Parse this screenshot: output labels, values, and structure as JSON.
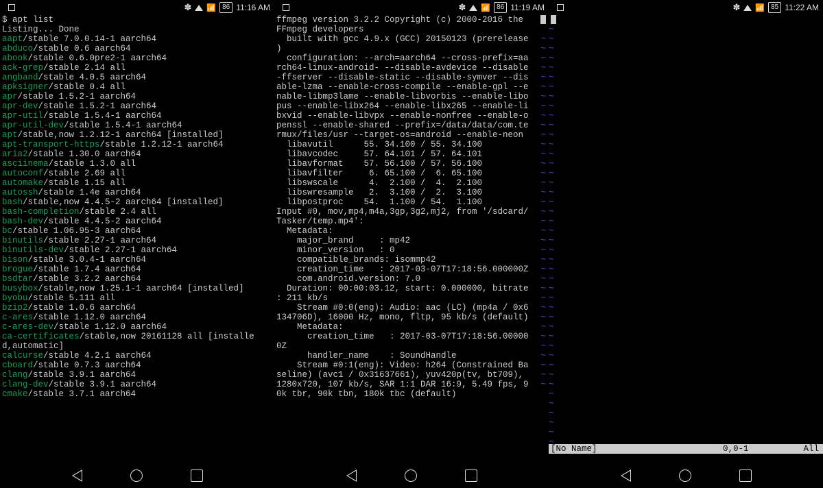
{
  "status": [
    {
      "battery": "86",
      "time": "11:16 AM"
    },
    {
      "battery": "86",
      "time": "11:19 AM"
    },
    {
      "battery": "85",
      "time": "11:22 AM"
    }
  ],
  "col1": {
    "prompt": "$ apt list",
    "listing": "Listing... Done",
    "packages": [
      [
        "aapt",
        "/stable 7.0.0.14-1 aarch64"
      ],
      [
        "abduco",
        "/stable 0.6 aarch64"
      ],
      [
        "abook",
        "/stable 0.6.0pre2-1 aarch64"
      ],
      [
        "ack-grep",
        "/stable 2.14 all"
      ],
      [
        "angband",
        "/stable 4.0.5 aarch64"
      ],
      [
        "apksigner",
        "/stable 0.4 all"
      ],
      [
        "apr",
        "/stable 1.5.2-1 aarch64"
      ],
      [
        "apr-dev",
        "/stable 1.5.2-1 aarch64"
      ],
      [
        "apr-util",
        "/stable 1.5.4-1 aarch64"
      ],
      [
        "apr-util-dev",
        "/stable 1.5.4-1 aarch64"
      ],
      [
        "apt",
        "/stable,now 1.2.12-1 aarch64 [installed]"
      ],
      [
        "apt-transport-https",
        "/stable 1.2.12-1 aarch64"
      ],
      [
        "aria2",
        "/stable 1.30.0 aarch64"
      ],
      [
        "asciinema",
        "/stable 1.3.0 all"
      ],
      [
        "autoconf",
        "/stable 2.69 all"
      ],
      [
        "automake",
        "/stable 1.15 all"
      ],
      [
        "autossh",
        "/stable 1.4e aarch64"
      ],
      [
        "bash",
        "/stable,now 4.4.5-2 aarch64 [installed]"
      ],
      [
        "bash-completion",
        "/stable 2.4 all"
      ],
      [
        "bash-dev",
        "/stable 4.4.5-2 aarch64"
      ],
      [
        "bc",
        "/stable 1.06.95-3 aarch64"
      ],
      [
        "binutils",
        "/stable 2.27-1 aarch64"
      ],
      [
        "binutils-dev",
        "/stable 2.27-1 aarch64"
      ],
      [
        "bison",
        "/stable 3.0.4-1 aarch64"
      ],
      [
        "brogue",
        "/stable 1.7.4 aarch64"
      ],
      [
        "bsdtar",
        "/stable 3.2.2 aarch64"
      ],
      [
        "busybox",
        "/stable,now 1.25.1-1 aarch64 [installed]"
      ],
      [
        "byobu",
        "/stable 5.111 all"
      ],
      [
        "bzip2",
        "/stable 1.0.6 aarch64"
      ],
      [
        "c-ares",
        "/stable 1.12.0 aarch64"
      ],
      [
        "c-ares-dev",
        "/stable 1.12.0 aarch64"
      ],
      [
        "ca-certificates",
        "/stable,now 20161128 all [installe"
      ],
      [
        "",
        "d,automatic]"
      ],
      [
        "calcurse",
        "/stable 4.2.1 aarch64"
      ],
      [
        "cboard",
        "/stable 0.7.3 aarch64"
      ],
      [
        "clang",
        "/stable 3.9.1 aarch64"
      ],
      [
        "clang-dev",
        "/stable 3.9.1 aarch64"
      ],
      [
        "cmake",
        "/stable 3.7.1 aarch64"
      ]
    ]
  },
  "col2_lines": [
    "ffmpeg version 3.2.2 Copyright (c) 2000-2016 the ",
    "FFmpeg developers",
    "  built with gcc 4.9.x (GCC) 20150123 (prerelease",
    ")",
    "  configuration: --arch=aarch64 --cross-prefix=aa",
    "rch64-linux-android- --disable-avdevice --disable",
    "-ffserver --disable-static --disable-symver --dis",
    "able-lzma --enable-cross-compile --enable-gpl --e",
    "nable-libmp3lame --enable-libvorbis --enable-libo",
    "pus --enable-libx264 --enable-libx265 --enable-li",
    "bxvid --enable-libvpx --enable-nonfree --enable-o",
    "penssl --enable-shared --prefix=/data/data/com.te",
    "rmux/files/usr --target-os=android --enable-neon ",
    "  libavutil      55. 34.100 / 55. 34.100",
    "  libavcodec     57. 64.101 / 57. 64.101",
    "  libavformat    57. 56.100 / 57. 56.100",
    "  libavfilter     6. 65.100 /  6. 65.100",
    "  libswscale      4.  2.100 /  4.  2.100",
    "  libswresample   2.  3.100 /  2.  3.100",
    "  libpostproc    54.  1.100 / 54.  1.100",
    "Input #0, mov,mp4,m4a,3gp,3g2,mj2, from '/sdcard/",
    "Tasker/temp.mp4':",
    "  Metadata:",
    "    major_brand     : mp42",
    "    minor_version   : 0",
    "    compatible_brands: isommp42",
    "    creation_time   : 2017-03-07T17:18:56.000000Z",
    "    com.android.version: 7.0",
    "  Duration: 00:00:03.12, start: 0.000000, bitrate",
    ": 211 kb/s",
    "    Stream #0:0(eng): Audio: aac (LC) (mp4a / 0x6",
    "134706D), 16000 Hz, mono, fltp, 95 kb/s (default)",
    "    Metadata:",
    "      creation_time   : 2017-03-07T17:18:56.00000",
    "0Z",
    "      handler_name    : SoundHandle",
    "    Stream #0:1(eng): Video: h264 (Constrained Ba",
    "seline) (avc1 / 0x31637661), yuv420p(tv, bt709), ",
    "1280x720, 107 kb/s, SAR 1:1 DAR 16:9, 5.49 fps, 9",
    "0k tbr, 90k tbn, 180k tbc (default)"
  ],
  "col2_tildes_from_line": 2,
  "vim_status": {
    "name": "[No Name]",
    "pos": "0,0-1",
    "all": "All"
  },
  "col3_tilde_count": 45
}
